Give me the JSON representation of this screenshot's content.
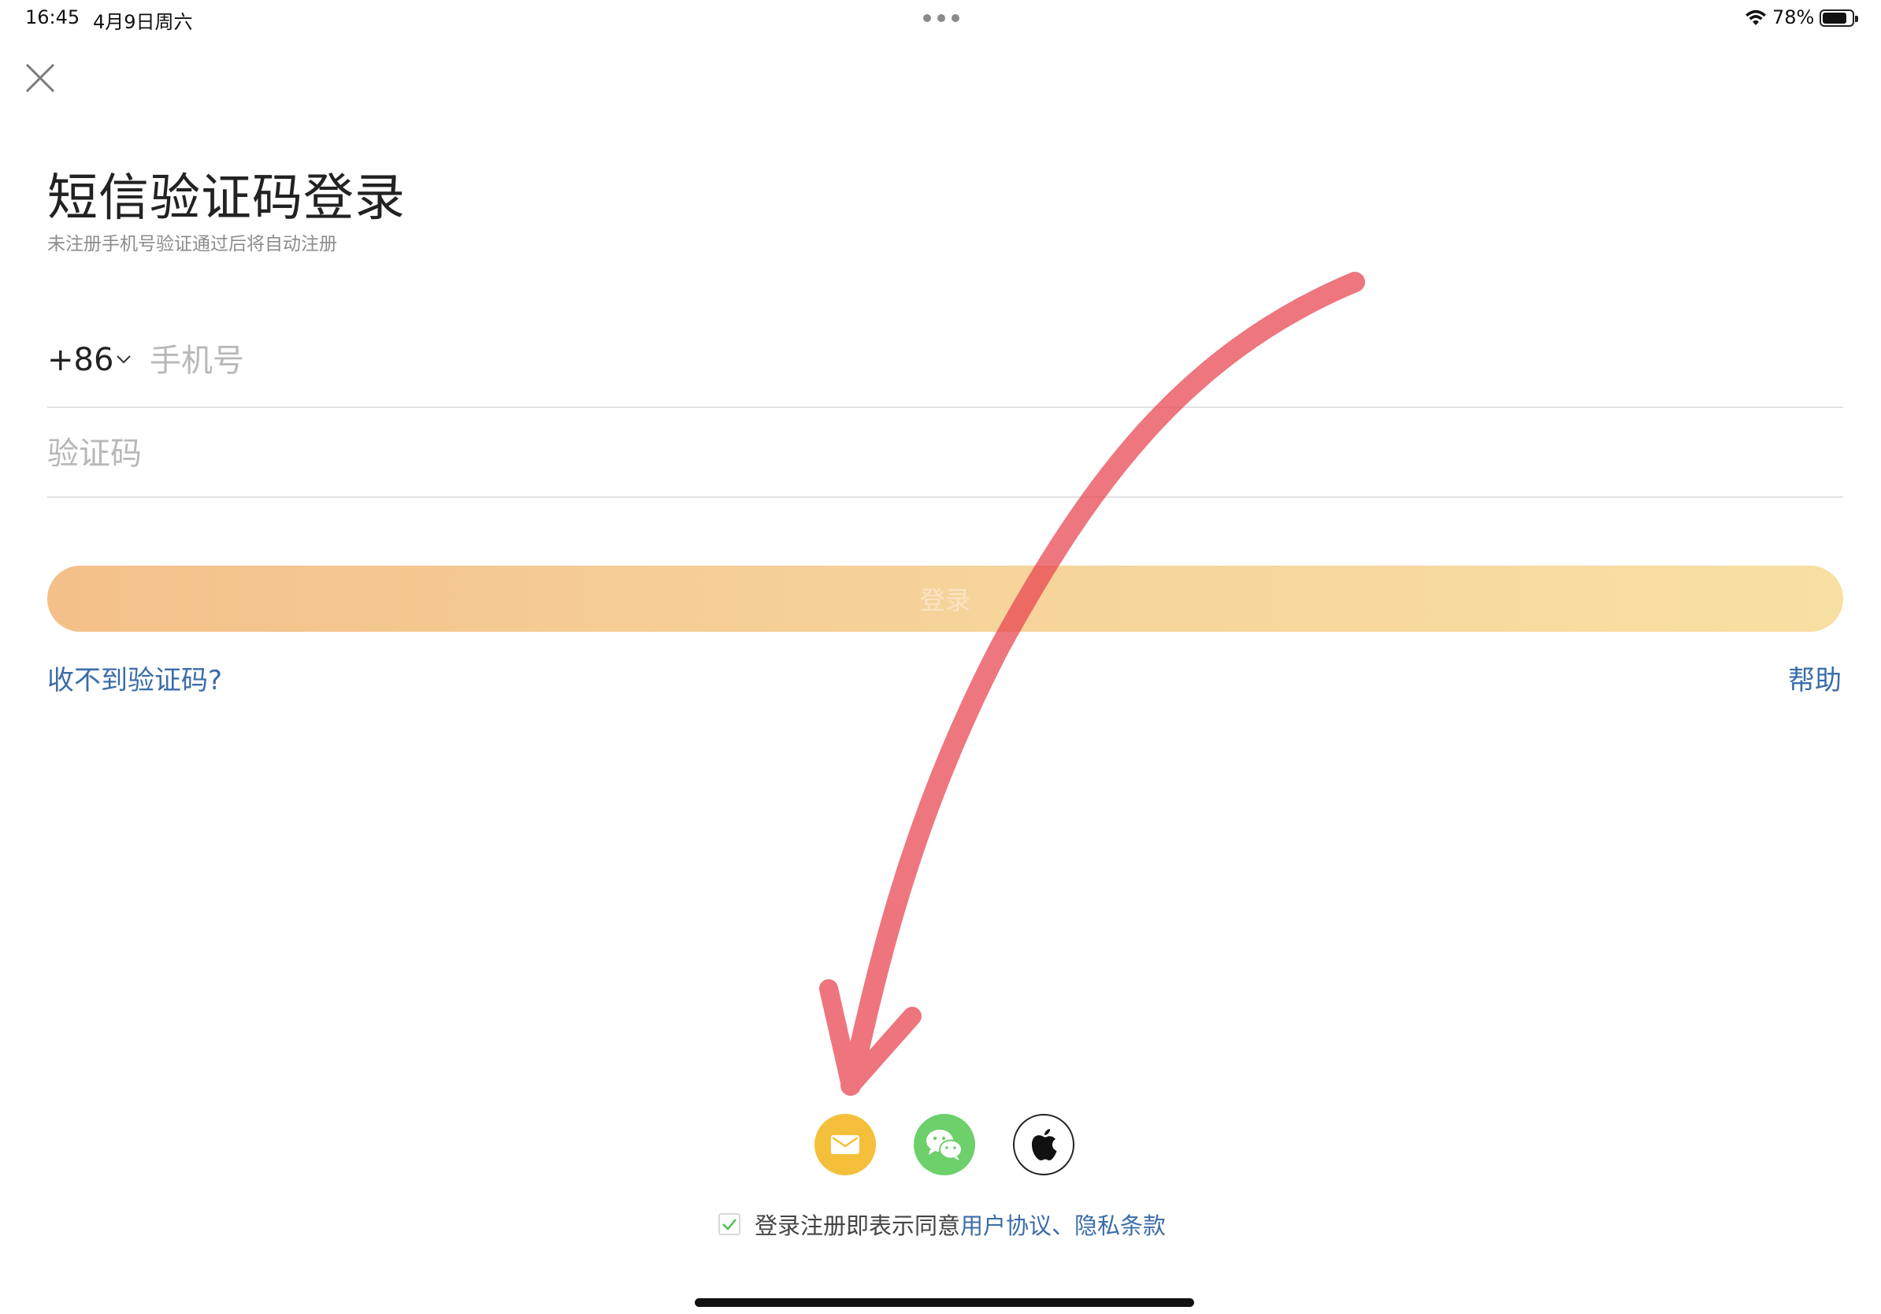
{
  "status_bar": {
    "time": "16:45",
    "date": "4月9日周六",
    "battery_percent": "78%",
    "battery_level": 0.78
  },
  "header": {
    "title": "短信验证码登录",
    "subtitle": "未注册手机号验证通过后将自动注册"
  },
  "form": {
    "country_code": "+86",
    "phone_placeholder": "手机号",
    "phone_value": "",
    "code_placeholder": "验证码",
    "code_value": "",
    "login_label": "登录"
  },
  "links": {
    "no_code": "收不到验证码?",
    "help": "帮助"
  },
  "social_login": [
    {
      "icon": "mail-icon",
      "color": "#f4c03b"
    },
    {
      "icon": "wechat-icon",
      "color": "#6dd06a"
    },
    {
      "icon": "apple-icon",
      "color": "#ffffff"
    }
  ],
  "agreement": {
    "checked": true,
    "prefix": "登录注册即表示同意",
    "user_agreement": "用户协议",
    "separator": "、",
    "privacy": "隐私条款"
  },
  "colors": {
    "accent_link": "#3b6da8",
    "button_gradient_start": "#f4c08a",
    "button_gradient_end": "#f8dfa2",
    "annotation_arrow": "#e8414d"
  }
}
